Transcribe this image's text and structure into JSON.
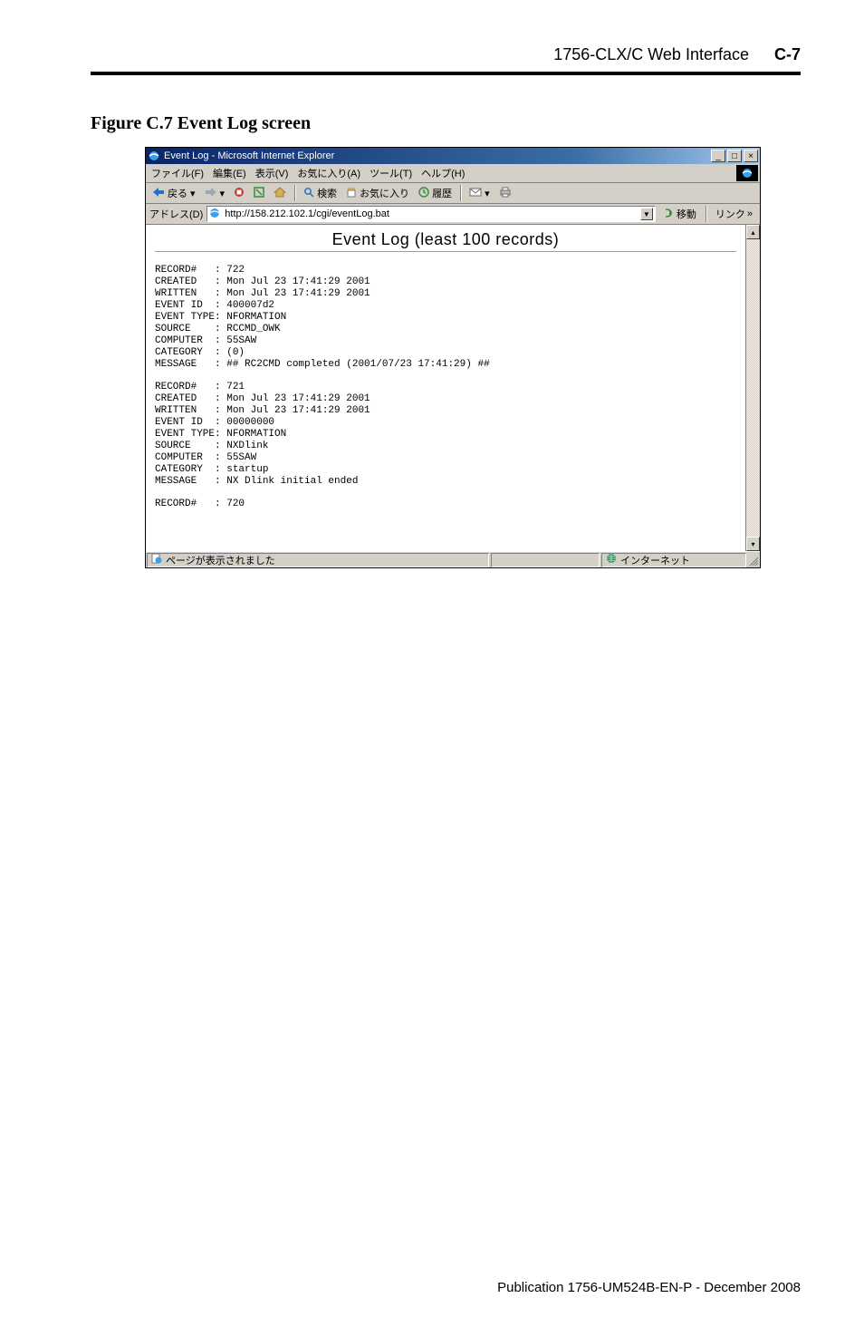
{
  "page_header": {
    "crumb": "1756-CLX/C Web Interface",
    "pagenum": "C-7"
  },
  "figure_caption": "Figure C.7 Event Log screen",
  "window": {
    "title": "Event Log - Microsoft Internet Explorer",
    "sys_buttons": {
      "min": "_",
      "max": "□",
      "close": "×"
    }
  },
  "menubar": {
    "items": [
      "ファイル(F)",
      "編集(E)",
      "表示(V)",
      "お気に入り(A)",
      "ツール(T)",
      "ヘルプ(H)"
    ]
  },
  "toolbar": {
    "back": "戻る",
    "search": "検索",
    "favorites": "お気に入り",
    "history": "履歴"
  },
  "addressbar": {
    "label": "アドレス(D)",
    "url": "http://158.212.102.1/cgi/eventLog.bat",
    "go": "移動",
    "links": "リンク"
  },
  "content": {
    "heading": "Event Log (least 100 records)",
    "records": [
      {
        "recordno": "722",
        "created": "Mon Jul 23 17:41:29 2001",
        "written": "Mon Jul 23 17:41:29 2001",
        "event_id": "400007d2",
        "event_type": "NFORMATION",
        "source": "RCCMD_OWK",
        "computer": "55SAW",
        "category": "(0)",
        "message": "## RC2CMD completed (2001/07/23 17:41:29) ##"
      },
      {
        "recordno": "721",
        "created": "Mon Jul 23 17:41:29 2001",
        "written": "Mon Jul 23 17:41:29 2001",
        "event_id": "00000000",
        "event_type": "NFORMATION",
        "source": "NXDlink",
        "computer": "55SAW",
        "category": "startup",
        "message": "NX Dlink initial ended"
      },
      {
        "recordno": "720",
        "created": ""
      }
    ]
  },
  "statusbar": {
    "left": "ページが表示されました",
    "right": "インターネット"
  },
  "footer": "Publication 1756-UM524B-EN-P - December 2008"
}
